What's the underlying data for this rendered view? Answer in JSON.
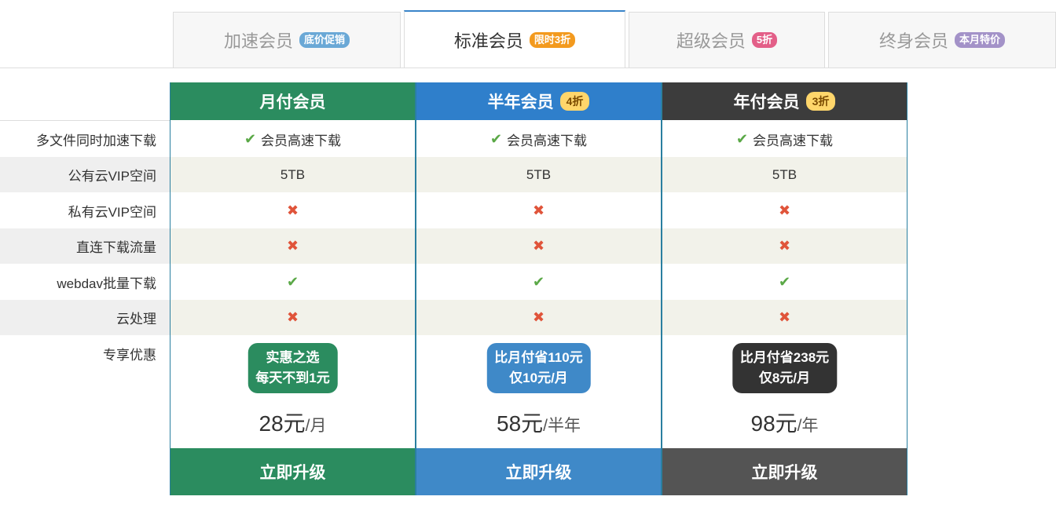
{
  "tabs": [
    {
      "label": "加速会员",
      "badge": "底价促销",
      "badge_color": "#6aa8d6",
      "active": false
    },
    {
      "label": "标准会员",
      "badge": "限时3折",
      "badge_color": "#f39a1e",
      "active": true
    },
    {
      "label": "超级会员",
      "badge": "5折",
      "badge_color": "#e35f88",
      "active": false
    },
    {
      "label": "终身会员",
      "badge": "本月特价",
      "badge_color": "#a392c8",
      "active": false
    }
  ],
  "row_labels": [
    "多文件同时加速下载",
    "公有云VIP空间",
    "私有云VIP空间",
    "直连下载流量",
    "webdav批量下载",
    "云处理",
    "专享优惠"
  ],
  "plans": [
    {
      "name": "月付会员",
      "discount": "",
      "header_color": "#2b8c5f",
      "button_color": "#2b8c5f",
      "features": {
        "accel": "会员高速下载",
        "public_space": "5TB",
        "private_space": false,
        "direct_traffic": false,
        "webdav": true,
        "cloud": false
      },
      "offer_line1": "实惠之选",
      "offer_line2": "每天不到1元",
      "offer_color": "#2b8c5f",
      "price": "28元",
      "unit": "/月",
      "button": "立即升级"
    },
    {
      "name": "半年会员",
      "discount": "4折",
      "header_color": "#2f7fcb",
      "button_color": "#3f89c8",
      "features": {
        "accel": "会员高速下载",
        "public_space": "5TB",
        "private_space": false,
        "direct_traffic": false,
        "webdav": true,
        "cloud": false
      },
      "offer_line1": "比月付省110元",
      "offer_line2": "仅10元/月",
      "offer_color": "#3f89c8",
      "price": "58元",
      "unit": "/半年",
      "button": "立即升级"
    },
    {
      "name": "年付会员",
      "discount": "3折",
      "header_color": "#3c3c3c",
      "button_color": "#545454",
      "features": {
        "accel": "会员高速下载",
        "public_space": "5TB",
        "private_space": false,
        "direct_traffic": false,
        "webdav": true,
        "cloud": false
      },
      "offer_line1": "比月付省238元",
      "offer_line2": "仅8元/月",
      "offer_color": "#333333",
      "price": "98元",
      "unit": "/年",
      "button": "立即升级"
    }
  ],
  "icons": {
    "check": "check-icon",
    "cross": "cross-icon"
  }
}
